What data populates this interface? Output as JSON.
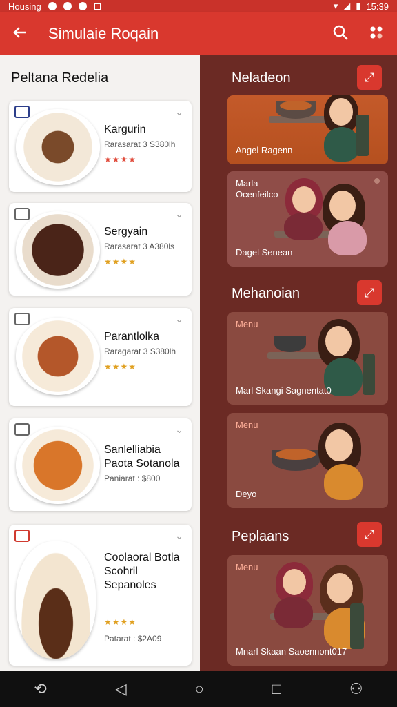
{
  "status_bar": {
    "left_text": "Housing",
    "time": "15:39"
  },
  "app_bar": {
    "title": "Simulaie Roqain",
    "back_icon": "arrow-left-icon",
    "search_icon": "search-icon",
    "more_icon": "dots-icon"
  },
  "left_pane": {
    "section_title": "Peltana Redelia",
    "items": [
      {
        "name": "Kargurin",
        "price": "Rarasarat 3 S380lh",
        "rating": "★★★★"
      },
      {
        "name": "Sergyain",
        "price": "Rarasarat 3 A380ls",
        "rating": "★★★★"
      },
      {
        "name": "Parantlolka",
        "price": "Raragarat 3 S380lh",
        "rating": "★★★★"
      },
      {
        "name": "Sanlelliabia Paota Sotanola",
        "price": "Paniarat : $800",
        "rating": ""
      },
      {
        "name": "Coolaoral Botla Scohril Sepanoles",
        "price": "Patarat : $2A09",
        "rating": "★★★★"
      }
    ]
  },
  "right_pane": {
    "groups": [
      {
        "title": "Neladeon",
        "cards": [
          {
            "tag": "",
            "caption": "Angel Ragenn"
          },
          {
            "tag": "Marla Ocenfeilco",
            "caption": "Dagel Senean"
          }
        ]
      },
      {
        "title": "Mehanoian",
        "cards": [
          {
            "tag": "Menu",
            "caption": "Marl Skangi Sagnentat0"
          },
          {
            "tag": "Menu",
            "caption": "Deyo"
          }
        ]
      },
      {
        "title": "Peplaans",
        "cards": [
          {
            "tag": "Menu",
            "caption": "Mnarl Skaan Saoennont017"
          }
        ]
      }
    ]
  },
  "nav_bar": {
    "icons": [
      "rotate-icon",
      "back-triangle-icon",
      "home-circle-icon",
      "recents-square-icon",
      "accessibility-icon"
    ]
  },
  "colors": {
    "primary": "#d9382e",
    "right_pane_bg": "#6b2a24"
  }
}
